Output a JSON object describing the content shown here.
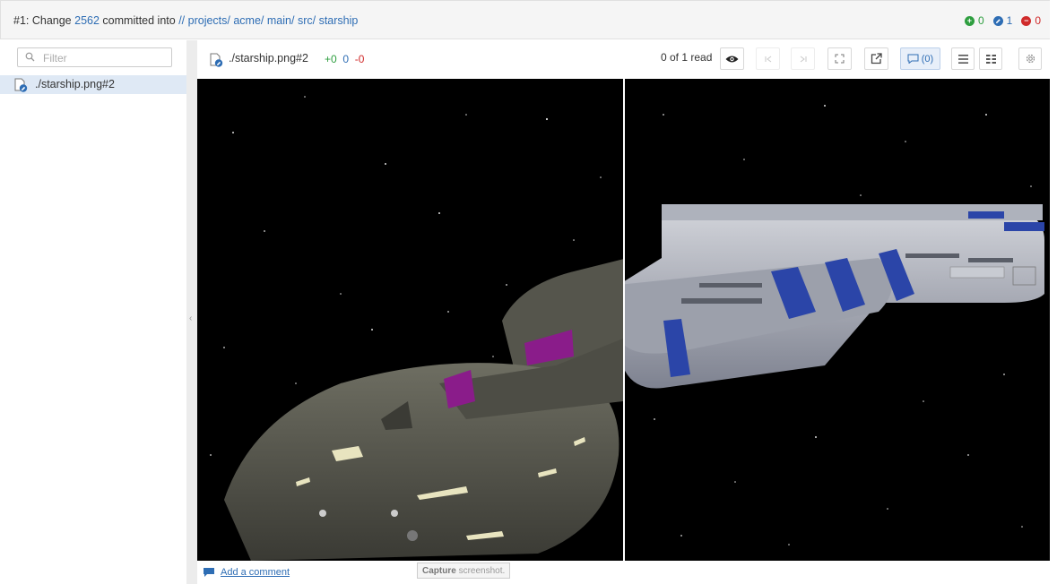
{
  "header": {
    "prefix": "#1: Change",
    "change_number": "2562",
    "committed_text": "committed into",
    "path_root": "//",
    "path": [
      "projects/",
      "acme/",
      "main/",
      "src/",
      "starship"
    ],
    "counts": {
      "added": "0",
      "edited": "1",
      "deleted": "0"
    }
  },
  "sidebar": {
    "filter_placeholder": "Filter",
    "files": [
      {
        "name": "./starship.png#2"
      }
    ]
  },
  "file_header": {
    "name": "./starship.png#2",
    "stats": {
      "added": "+0",
      "edited": "0",
      "deleted": "-0"
    },
    "read_status": "0 of 1 read",
    "comments_count": "(0)"
  },
  "footer": {
    "add_comment": "Add a comment",
    "tooltip_bold": "Capture",
    "tooltip_text": " screenshot."
  },
  "colors": {
    "link": "#2e6db4",
    "added": "#2e9e3f",
    "edited": "#2e6db4",
    "deleted": "#d02b2b",
    "selected_row": "#dfe9f5"
  },
  "icons": [
    "search-icon",
    "file-edit-icon",
    "eye-icon",
    "first-icon",
    "last-icon",
    "fullscreen-icon",
    "external-link-icon",
    "comment-icon",
    "list-view-icon",
    "grid-view-icon",
    "gear-icon",
    "collapse-left-icon"
  ]
}
